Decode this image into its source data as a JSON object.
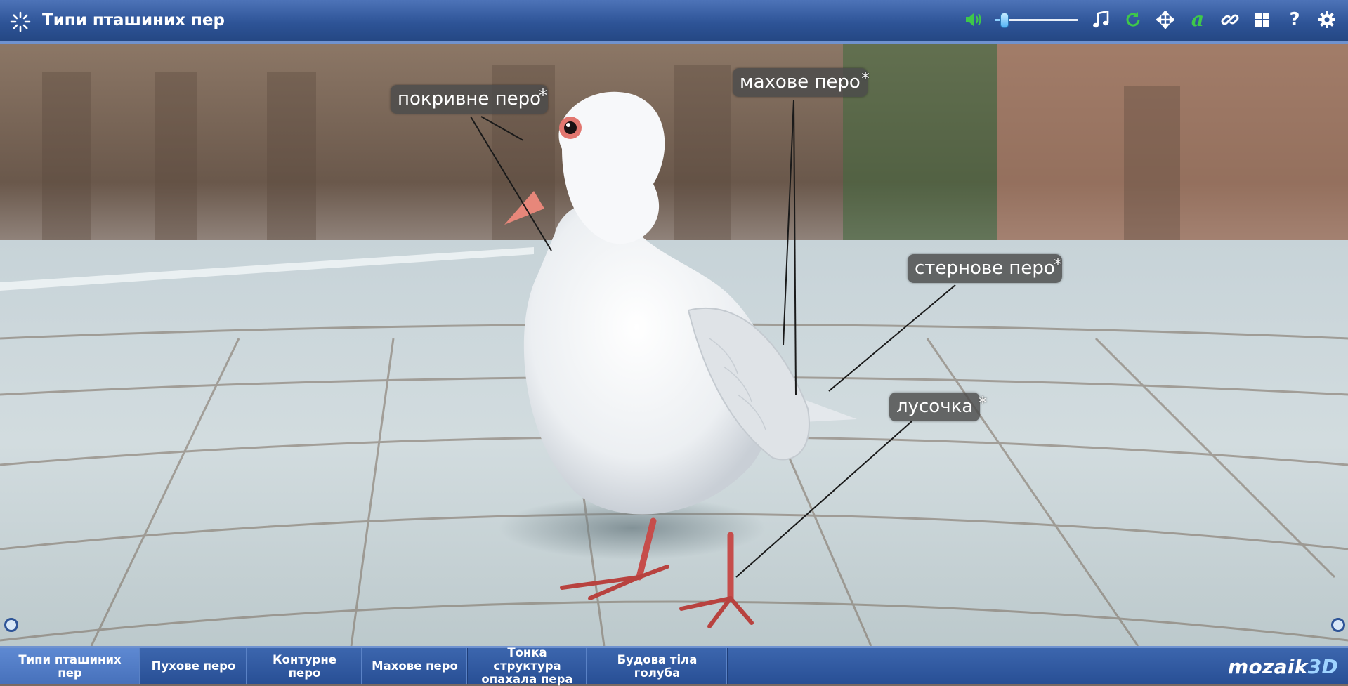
{
  "app": {
    "title": "Типи пташиних пер",
    "brand": "mozaik",
    "brand_suffix": "3D"
  },
  "toolbar": {
    "icons": [
      "volume-icon",
      "music-icon",
      "reset-icon",
      "move-icon",
      "text-label-icon",
      "link-icon",
      "grid-icon",
      "help-icon",
      "settings-icon"
    ],
    "volume_level": 0.1,
    "text_icon_glyph": "a",
    "help_glyph": "?",
    "colors": {
      "accent_green": "#3ec84a",
      "icon_white": "#ffffff"
    }
  },
  "scene": {
    "labels": [
      {
        "text": "покривне перо",
        "star": "*"
      },
      {
        "text": "махове перо",
        "star": "*"
      },
      {
        "text": "стернове перо",
        "star": "*"
      },
      {
        "text": "лусочка",
        "star": "*"
      }
    ]
  },
  "tabs": [
    {
      "label": "Типи пташиних пер",
      "active": true
    },
    {
      "label": "Пухове перо"
    },
    {
      "label": "Контурне перо"
    },
    {
      "label": "Махове перо"
    },
    {
      "label": "Тонка структура",
      "label2": "опахала пера"
    },
    {
      "label": "Будова тіла голуба"
    }
  ]
}
